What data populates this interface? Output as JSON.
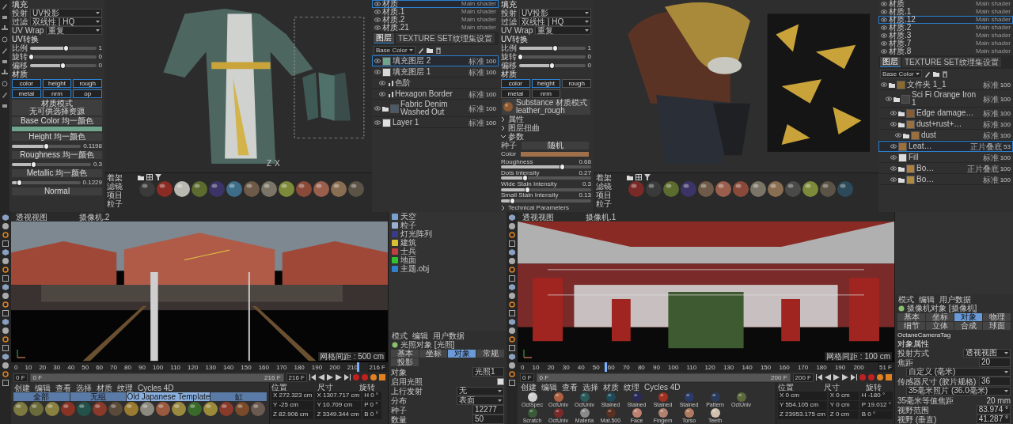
{
  "left_props": {
    "fill_title": "填充",
    "fields": [
      {
        "label": "投射",
        "value": "UV投影"
      },
      {
        "label": "过滤",
        "value": "双线性 | HQ"
      },
      {
        "label": "UV Wrap",
        "value": "重复"
      }
    ],
    "uv_title": "UV转换",
    "sliders": [
      {
        "label": "比例",
        "reading": "1",
        "level": 0.55
      },
      {
        "label": "旋转",
        "reading": "0",
        "level": 0.02
      },
      {
        "label": "偏移",
        "reading": "0",
        "level": 0.5
      }
    ],
    "material_title": "材质",
    "channels": [
      {
        "label": "color",
        "on": true
      },
      {
        "label": "height",
        "on": true
      },
      {
        "label": "rough",
        "on": true
      },
      {
        "label": "metal",
        "on": true
      },
      {
        "label": "nrm",
        "on": true
      },
      {
        "label": "op",
        "on": true
      }
    ],
    "mode_button": {
      "title": "材质模式",
      "subtitle": "无可供选择资源"
    },
    "inputs": [
      {
        "kind": "color",
        "label": "Base Color",
        "sub": "均一颜色",
        "color": "#6fa58d"
      },
      {
        "kind": "slider",
        "label": "Height",
        "sub": "均一颜色",
        "reading": "0.1198",
        "level": 0.5
      },
      {
        "kind": "slider",
        "label": "Roughness",
        "sub": "均一颜色",
        "reading": "0.3",
        "level": 0.28
      },
      {
        "kind": "slider",
        "label": "Metallic",
        "sub": "均一颜色",
        "reading": "0.1229",
        "level": 0.12
      },
      {
        "kind": "label",
        "label": "Normal"
      }
    ]
  },
  "left_viewport": {
    "axis_labels": [
      "Z",
      "X"
    ]
  },
  "left_shelf": {
    "title": "着架",
    "categories": [
      "滤镜",
      "项目",
      "粒子"
    ],
    "materials": [
      {
        "color": "#3a3a3a"
      },
      {
        "color": "#8a2b24"
      },
      {
        "color": "#b9b9b2"
      },
      {
        "color": "#5c6b2e"
      },
      {
        "color": "#3c3366"
      },
      {
        "color": "#3e6d8a"
      },
      {
        "color": "#6e5a48"
      },
      {
        "color": "#7a7566"
      },
      {
        "color": "#7d8a3a"
      },
      {
        "color": "#8a4a3a"
      },
      {
        "color": "#9a5f4c"
      },
      {
        "color": "#8a6e52"
      },
      {
        "color": "#5a5346"
      }
    ]
  },
  "left_layers": {
    "materials": [
      {
        "name": "材质",
        "shader": "Main shader",
        "selected": true
      },
      {
        "name": "材质.1",
        "shader": "Main shader",
        "selected": false
      },
      {
        "name": "材质.2",
        "shader": "Main shader",
        "selected": false
      },
      {
        "name": "材质.21",
        "shader": "Main shader",
        "selected": false
      }
    ],
    "tabs": [
      {
        "label": "图层",
        "selected": true
      },
      {
        "label": "TEXTURE SET纹理集设置",
        "selected": false
      }
    ],
    "channel": "Base Color",
    "layers": [
      {
        "kind": "fill",
        "name": "填充图层 2",
        "blend": "标准",
        "opacity": "100",
        "color": "#6fa58d",
        "selected": true
      },
      {
        "kind": "fill",
        "name": "填充图层 1",
        "blend": "标准",
        "opacity": "100",
        "color": "#d8d8d8",
        "selected": false,
        "children": [
          {
            "kind": "effect",
            "name": "色阶",
            "selected": false
          },
          {
            "kind": "effect",
            "name": "Hexagon Border",
            "blend": "标准",
            "opacity": "100",
            "selected": false
          }
        ]
      },
      {
        "kind": "folder",
        "name": "Fabric Denim Washed Out",
        "blend": "标准",
        "opacity": "100",
        "color": "#4a5a6a",
        "selected": false
      },
      {
        "kind": "fill",
        "name": "Layer 1",
        "blend": "标准",
        "opacity": "100",
        "color": "#e0e0e0",
        "selected": false
      }
    ]
  },
  "right_props": {
    "fill_title": "填充",
    "fields": [
      {
        "label": "投射",
        "value": "UV投影"
      },
      {
        "label": "过滤",
        "value": "双线性 | HQ"
      },
      {
        "label": "UV Wrap",
        "value": "重复"
      }
    ],
    "uv_title": "UV转换",
    "sliders": [
      {
        "label": "比例",
        "reading": "1",
        "level": 0.55
      },
      {
        "label": "旋转",
        "reading": "0",
        "level": 0.02
      },
      {
        "label": "偏移",
        "reading": "0",
        "level": 0.5
      }
    ],
    "material_title": "材质",
    "channels": [
      {
        "label": "color",
        "on": true
      },
      {
        "label": "height",
        "on": true
      },
      {
        "label": "rough",
        "on": false
      },
      {
        "label": "metal",
        "on": false
      },
      {
        "label": "nrm",
        "on": false
      }
    ],
    "substance": {
      "title": "Substance 材质模式",
      "subtitle": "leather_rough"
    },
    "sections": [
      {
        "label": "属性",
        "expanded": false
      },
      {
        "label": "图层扭曲",
        "expanded": false
      },
      {
        "label": "参数",
        "expanded": true
      }
    ],
    "params": [
      {
        "kind": "button",
        "label": "种子",
        "value": "随机"
      },
      {
        "kind": "color",
        "label": "Color",
        "color": "#a0704a"
      },
      {
        "kind": "slider",
        "label": "Roughness",
        "reading": "0.68",
        "level": 0.68
      },
      {
        "kind": "slider",
        "label": "Dots Intensity",
        "reading": "0.27",
        "level": 0.27
      },
      {
        "kind": "slider",
        "label": "Wide Stain Intensity",
        "reading": "0.3",
        "level": 0.3
      },
      {
        "kind": "slider",
        "label": "Small Stain Intensity",
        "reading": "0.13",
        "level": 0.13
      }
    ],
    "footer": {
      "label": "Technical Parameters",
      "expanded": false
    }
  },
  "right_shelf": {
    "title": "着架",
    "categories": [
      "滤镜",
      "项目",
      "粒子"
    ],
    "materials": [
      {
        "color": "#7a2a26"
      },
      {
        "color": "#3a3a3a"
      },
      {
        "color": "#5c6b2e"
      },
      {
        "color": "#3c3366"
      },
      {
        "color": "#6e5a48"
      },
      {
        "color": "#9a5f4c"
      },
      {
        "color": "#8a4a3a"
      },
      {
        "color": "#7a7566"
      },
      {
        "color": "#8a6e52"
      },
      {
        "color": "#4a4a48"
      },
      {
        "color": "#7d8a3a"
      },
      {
        "color": "#5a5346"
      },
      {
        "color": "#2c4a5a"
      }
    ]
  },
  "right_layers": {
    "materials": [
      {
        "name": "材质",
        "shader": "Main shader",
        "selected": false
      },
      {
        "name": "材质.1",
        "shader": "Main shader",
        "selected": false
      },
      {
        "name": "材质.12",
        "shader": "Main shader",
        "selected": true
      },
      {
        "name": "材质.2",
        "shader": "Main shader",
        "selected": false
      },
      {
        "name": "材质.3",
        "shader": "Main shader",
        "selected": false
      },
      {
        "name": "材质.7",
        "shader": "Main shader",
        "selected": false
      },
      {
        "name": "材质.8",
        "shader": "Main shader",
        "selected": false
      }
    ],
    "tabs": [
      {
        "label": "图层",
        "selected": true
      },
      {
        "label": "TEXTURE SET纹理集设置",
        "selected": false
      }
    ],
    "channel": "Base Color",
    "layers": [
      {
        "kind": "folder",
        "name": "文件夹 1_1",
        "blend": "标准",
        "opacity": "100",
        "color": "#8a6a30",
        "selected": false,
        "children": [
          {
            "kind": "folder",
            "name": "Sci Fi Orange Iron 1",
            "blend": "标准",
            "opacity": "100",
            "color": "#444444",
            "selected": false,
            "children": [
              {
                "kind": "folder",
                "name": "Edge damage…",
                "blend": "标准",
                "opacity": "100",
                "color": "#8a5a30",
                "selected": false
              },
              {
                "kind": "folder",
                "name": "dust+rust+…",
                "blend": "标准",
                "opacity": "100",
                "color": "#9a7040",
                "selected": false,
                "children": [
                  {
                    "kind": "folder",
                    "name": "dust",
                    "blend": "标准",
                    "opacity": "100",
                    "color": "#9a7040",
                    "selected": false
                  }
                ]
              },
              {
                "kind": "fill",
                "name": "Leat…",
                "blend": "正片叠底",
                "opacity": "53",
                "color": "#a0703a",
                "selected": true
              },
              {
                "kind": "fill",
                "name": "Fill",
                "blend": "标准",
                "opacity": "100",
                "color": "#dddddd",
                "selected": false
              },
              {
                "kind": "folder",
                "name": "Bo…",
                "blend": "正片叠底",
                "opacity": "100",
                "color": "#b08040",
                "selected": false
              },
              {
                "kind": "folder",
                "name": "Bo…",
                "blend": "标准",
                "opacity": "100",
                "color": "#b08a40",
                "selected": false
              }
            ]
          }
        ]
      }
    ]
  },
  "c4d_left": {
    "viewport_title": "透视视图",
    "camera": "摄像机.2",
    "grid_note": "网格间距 : 500 cm",
    "kind": "exterior",
    "ticks": [
      "0",
      "10",
      "20",
      "30",
      "40",
      "50",
      "60",
      "70",
      "80",
      "90",
      "100",
      "110",
      "120",
      "130",
      "140",
      "150",
      "160",
      "170",
      "180",
      "190",
      "200",
      "210"
    ],
    "playhead": {
      "level": 0.99
    },
    "frame_field": "216 F",
    "range": {
      "level": 1
    },
    "start_field": "0 F",
    "range_start": "0 F",
    "range_end": "216 F",
    "end_field": "216 F",
    "menu": [
      "创建",
      "编辑",
      "查看",
      "选择",
      "材质",
      "纹理",
      "Cycles 4D"
    ],
    "material_tabs": [
      {
        "label": "全部",
        "selected": false
      },
      {
        "label": "无组",
        "selected": false
      },
      {
        "label": "Old Japanese Template",
        "selected": true
      },
      {
        "label": "缸",
        "selected": false
      }
    ],
    "materials": [
      {
        "color": "#7d7a40"
      },
      {
        "color": "#6a6a3a"
      },
      {
        "color": "#8a8040"
      },
      {
        "color": "#8a3324"
      },
      {
        "color": "#23524a"
      },
      {
        "color": "#8a3a2a"
      },
      {
        "color": "#5a4a3a"
      },
      {
        "color": "#9a7a30"
      },
      {
        "color": "#8a8a80"
      },
      {
        "color": "#9a5a40"
      },
      {
        "color": "#9a8a40"
      },
      {
        "color": "#3a6a2a"
      },
      {
        "color": "#9a8a3a"
      },
      {
        "color": "#8a3a2a"
      },
      {
        "color": "#7a4a2a"
      },
      {
        "color": "#6a5a50"
      }
    ],
    "coords": {
      "headers": [
        "位置",
        "尺寸",
        "旋转"
      ],
      "rows": [
        [
          {
            "axis": "X",
            "value": "272.323 cm"
          },
          {
            "axis": "X",
            "value": "1307.717 cm"
          },
          {
            "axis": "H",
            "value": "0 °"
          }
        ],
        [
          {
            "axis": "Y",
            "value": "-25 cm"
          },
          {
            "axis": "Y",
            "value": "10.709 cm"
          },
          {
            "axis": "P",
            "value": "0 °"
          }
        ],
        [
          {
            "axis": "Z",
            "value": "82.906 cm"
          },
          {
            "axis": "Z",
            "value": "3349.344 cm"
          },
          {
            "axis": "B",
            "value": "0 °"
          }
        ]
      ]
    },
    "objects": [
      {
        "name": "天空",
        "color": "#7aa0d0"
      },
      {
        "name": "粒子",
        "color": "#9ab0d0"
      },
      {
        "name": "灯光阵列",
        "color": "#3a3a8a"
      },
      {
        "name": "建筑",
        "color": "#d8c030"
      },
      {
        "name": "士兵",
        "color": "#c04040"
      },
      {
        "name": "地面",
        "color": "#30c030"
      },
      {
        "name": "主题.obj",
        "color": "#3080d0"
      }
    ],
    "attributes": {
      "menu": [
        "模式",
        "编辑",
        "用户数据"
      ],
      "title": "光照对象 [光照]",
      "tabs": [
        {
          "label": "基本",
          "selected": false
        },
        {
          "label": "坐标",
          "selected": false
        },
        {
          "label": "对象",
          "selected": true
        },
        {
          "label": "常规",
          "selected": false
        },
        {
          "label": "投影",
          "selected": false
        }
      ],
      "rows": [
        {
          "kind": "field",
          "label": "对象",
          "value": "光照1"
        },
        {
          "kind": "check",
          "label": "启用光照",
          "checked": true
        },
        {
          "kind": "dropdown",
          "label": "上行发射",
          "value": "无"
        },
        {
          "kind": "dropdown",
          "label": "分布",
          "value": "表面"
        },
        {
          "kind": "field",
          "label": "种子",
          "value": "12277"
        },
        {
          "kind": "field",
          "label": "数量",
          "value": "50"
        }
      ]
    }
  },
  "c4d_right": {
    "viewport_title": "透视视图",
    "camera": "摄像机.1",
    "grid_note": "网格间距 : 100 cm",
    "kind": "interior",
    "ticks": [
      "0",
      "10",
      "20",
      "30",
      "40",
      "50",
      "60",
      "70",
      "80",
      "90",
      "100",
      "110",
      "120",
      "130",
      "140",
      "150",
      "160",
      "170",
      "180",
      "190",
      "200"
    ],
    "playhead": {
      "level": 0.25
    },
    "frame_field": "51 F",
    "range": {
      "level": 1
    },
    "start_field": "0 F",
    "range_start": "0 F",
    "range_end": "200 F",
    "end_field": "200 F",
    "menu": [
      "创建",
      "编辑",
      "查看",
      "选择",
      "材质",
      "纹理",
      "Cycles 4D"
    ],
    "materials": [
      {
        "color": "#cfcfcf",
        "label": "OctSpec"
      },
      {
        "color": "#b06040",
        "label": "OctUniv"
      },
      {
        "color": "#2a5a5a",
        "label": "OctUniv"
      },
      {
        "color": "#1e4a5a",
        "label": "Stained"
      },
      {
        "color": "#2a2a5a",
        "label": "Stained"
      },
      {
        "color": "#a03020",
        "label": "Stained"
      },
      {
        "color": "#2a3a6a",
        "label": "Stained"
      },
      {
        "color": "#2a3a5a",
        "label": "Pattern"
      },
      {
        "color": "#5a6a3a",
        "label": "OctUniv"
      },
      {
        "color": "#3a5a3a",
        "label": "Scratch"
      },
      {
        "color": "#7a2a2a",
        "label": "OctUniv"
      },
      {
        "color": "#8a8a8a",
        "label": "Materia"
      },
      {
        "color": "#5a3020",
        "label": "Mat.500"
      },
      {
        "color": "#c08070",
        "label": "Face"
      },
      {
        "color": "#b08070",
        "label": "Fingern"
      },
      {
        "color": "#b07a60",
        "label": "Torso"
      },
      {
        "color": "#d0c0b0",
        "label": "Teeth"
      }
    ],
    "coords": {
      "headers": [
        "位置",
        "尺寸",
        "旋转"
      ],
      "rows": [
        [
          {
            "axis": "X",
            "value": "0 cm"
          },
          {
            "axis": "X",
            "value": "0 cm"
          },
          {
            "axis": "H",
            "value": "-180 °"
          }
        ],
        [
          {
            "axis": "Y",
            "value": "554.105 cm"
          },
          {
            "axis": "Y",
            "value": "0 cm"
          },
          {
            "axis": "P",
            "value": "19.012 °"
          }
        ],
        [
          {
            "axis": "Z",
            "value": "23953.175 cm"
          },
          {
            "axis": "Z",
            "value": "0 cm"
          },
          {
            "axis": "B",
            "value": "0 °"
          }
        ]
      ]
    },
    "attributes": {
      "menu": [
        "模式",
        "编辑",
        "用户数据"
      ],
      "title": "摄像机对象 [摄像机]",
      "tabs": [
        {
          "label": "基本",
          "selected": false
        },
        {
          "label": "坐标",
          "selected": false
        },
        {
          "label": "对象",
          "selected": true
        },
        {
          "label": "物理",
          "selected": false
        },
        {
          "label": "细节",
          "selected": false
        },
        {
          "label": "立体",
          "selected": false
        },
        {
          "label": "合成",
          "selected": false
        },
        {
          "label": "球面",
          "selected": false
        }
      ],
      "tag": "OctaneCameraTag",
      "section": "对象属性",
      "rows": [
        {
          "kind": "dropdown",
          "label": "投射方式",
          "value": "透视视图"
        },
        {
          "kind": "field",
          "label": "焦距",
          "value": "20",
          "extra": "自定义 (毫米)"
        },
        {
          "kind": "field",
          "label": "传感器尺寸 (胶片规格)",
          "value": "36",
          "extra": "35毫米照片 (36.0毫米)"
        },
        {
          "kind": "text",
          "label": "35毫米等值焦距",
          "value": "20 mm"
        },
        {
          "kind": "field",
          "label": "视野范围",
          "value": "83.974 °"
        },
        {
          "kind": "field",
          "label": "视野 (垂直)",
          "value": "41.287 °"
        }
      ]
    }
  }
}
